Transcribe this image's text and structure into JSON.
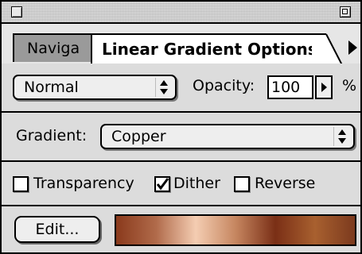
{
  "tabs": {
    "inactive_label": "Naviga",
    "active_label": "Linear Gradient Options"
  },
  "blend_mode": {
    "selected": "Normal"
  },
  "opacity": {
    "label": "Opacity:",
    "value": "100",
    "unit": "%"
  },
  "gradient": {
    "label": "Gradient:",
    "selected": "Copper",
    "preview_colors": [
      "#8a3a1c",
      "#b06a4a",
      "#f4cdb2",
      "#c68660",
      "#7a2f16",
      "#a8602f",
      "#7c3a1e"
    ]
  },
  "checkboxes": [
    {
      "label": "Transparency",
      "checked": false
    },
    {
      "label": "Dither",
      "checked": true
    },
    {
      "label": "Reverse",
      "checked": false
    }
  ],
  "edit_button": {
    "label": "Edit..."
  }
}
